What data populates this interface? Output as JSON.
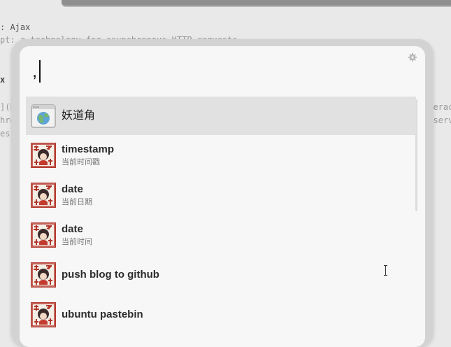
{
  "background_editor": {
    "lines": [
      {
        "text": ": Ajax",
        "style": "normal"
      },
      {
        "text": "pt: a technology for asynchronous HTTP requests",
        "style": "dim"
      },
      {
        "text": "x",
        "style": "bold"
      },
      {
        "text": "](ht",
        "style": "dim"
      },
      {
        "text": "hron",
        "style": "dim"
      },
      {
        "text": "es i",
        "style": "dim"
      },
      {
        "text": "nterac",
        "style": "dim"
      },
      {
        "text": "e serv",
        "style": "dim"
      }
    ]
  },
  "launcher": {
    "query": ",",
    "settings_icon": "gear-icon",
    "results": [
      {
        "title": "妖道角",
        "subtitle": "",
        "icon": "browser-window-icon",
        "selected": true
      },
      {
        "title": "timestamp",
        "subtitle": "当前时间戳",
        "icon": "seal-avatar-icon",
        "selected": false
      },
      {
        "title": "date",
        "subtitle": "当前日期",
        "icon": "seal-avatar-icon",
        "selected": false
      },
      {
        "title": "date",
        "subtitle": "当前时间",
        "icon": "seal-avatar-icon",
        "selected": false
      },
      {
        "title": "push blog to github",
        "subtitle": "",
        "icon": "seal-avatar-icon",
        "selected": false
      },
      {
        "title": "ubuntu pastebin",
        "subtitle": "",
        "icon": "seal-avatar-icon",
        "selected": false
      }
    ]
  },
  "colors": {
    "selected_row": "#e1e1e1",
    "panel": "#f7f7f7",
    "frame": "#d3d3d3",
    "seal_red": "#b3362c"
  }
}
